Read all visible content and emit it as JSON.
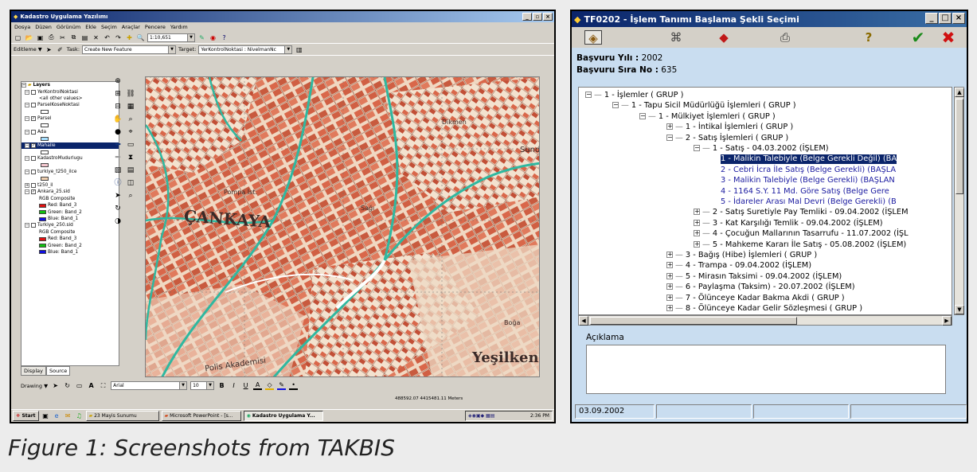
{
  "left_window": {
    "title": "Kadastro Uygulama Yazılımı",
    "menu": [
      "Dosya",
      "Düzen",
      "Görünüm",
      "Ekle",
      "Seçim",
      "Araçlar",
      "Pencere",
      "Yardım"
    ],
    "scale_value": "1:10,651",
    "editor_label": "Editleme ▼",
    "task_label": "Task:",
    "task_value": "Create New Feature",
    "target_label": "Target:",
    "target_value": "YerKontrolNoktasi : NivelmanNc",
    "layers_header": "Layers",
    "layers": [
      {
        "name": "YerKontrolNoktasi",
        "checked": false,
        "expanded": true
      },
      {
        "name": "<all other values>",
        "sub": true
      },
      {
        "name": "ParselKoseNoktasi",
        "checked": false,
        "expanded": true
      },
      {
        "name": "Parsel",
        "checked": true,
        "expanded": true
      },
      {
        "name": "Ada",
        "checked": false,
        "expanded": true
      },
      {
        "name": "Mahalle",
        "checked": true,
        "expanded": true,
        "selected": true
      },
      {
        "name": "KadastroMudurlugu",
        "checked": false,
        "expanded": true
      },
      {
        "name": "turkiye_t250_ilce",
        "checked": false,
        "expanded": true
      },
      {
        "name": "t250_il",
        "checked": false,
        "expanded": false
      },
      {
        "name": "Ankara_25.sid",
        "checked": true,
        "expanded": true
      },
      {
        "name": "RGB Composite",
        "sub": true
      },
      {
        "name": "Red:   Band_3",
        "sub": true,
        "color": "#e01010"
      },
      {
        "name": "Green: Band_2",
        "sub": true,
        "color": "#10c010"
      },
      {
        "name": "Blue:   Band_1",
        "sub": true,
        "color": "#1010e0"
      },
      {
        "name": "Turkiye_250.sid",
        "checked": false,
        "expanded": true
      },
      {
        "name": "RGB Composite",
        "sub": true
      },
      {
        "name": "Red:   Band_3",
        "sub": true,
        "color": "#e01010"
      },
      {
        "name": "Green: Band_2",
        "sub": true,
        "color": "#10c010"
      },
      {
        "name": "Blue:   Band_1",
        "sub": true,
        "color": "#1010e0"
      }
    ],
    "tabs": [
      "Display",
      "Source"
    ],
    "drawing_label": "Drawing ▼",
    "font_name": "Arial",
    "font_size": "10",
    "coords": "488592.07  4415481.11 Meters",
    "map_labels": [
      "ÇANKAYA",
      "Yeşilkent",
      "Dikmen",
      "Sund",
      "Polis Akademisi",
      "Sağı",
      "Pompa İst.",
      "Boğa"
    ],
    "taskbar": {
      "start": "Start",
      "items": [
        "23 Mayis Sunumu",
        "Microsoft PowerPoint - [s...",
        "Kadastro Uygulama Y..."
      ],
      "time": "2:36 PM"
    }
  },
  "right_window": {
    "title": "TF0202 - İşlem Tanımı Başlama Şekli Seçimi",
    "basvuru_yili_label": "Başvuru Yılı :",
    "basvuru_yili": "2002",
    "basvuru_sira_label": "Başvuru Sıra No :",
    "basvuru_sira": "635",
    "tree": [
      {
        "text": "1 - İşlemler ( GRUP )",
        "level": 0,
        "exp": "-"
      },
      {
        "text": "1 - Tapu Sicil Müdürlüğü İşlemleri ( GRUP )",
        "level": 1,
        "exp": "-"
      },
      {
        "text": "1 - Mülkiyet İşlemleri ( GRUP )",
        "level": 2,
        "exp": "-"
      },
      {
        "text": "1 - İntikal İşlemleri ( GRUP )",
        "level": 3,
        "exp": "+"
      },
      {
        "text": "2 - Satış İşlemleri ( GRUP )",
        "level": 3,
        "exp": "-"
      },
      {
        "text": "1 - Satış - 04.03.2002 (İŞLEM)",
        "level": 4,
        "exp": "-"
      },
      {
        "text": "1 - Malikin Talebiyle (Belge Gerekli Değil) (BA",
        "level": 5,
        "leaf": true,
        "selected": true
      },
      {
        "text": "2 - Cebri İcra İle Satış (Belge Gerekli) (BAŞLA",
        "level": 5,
        "leaf": true
      },
      {
        "text": "3 - Malikin Talebiyle (Belge Gerekli) (BAŞLAN",
        "level": 5,
        "leaf": true
      },
      {
        "text": "4 - 1164 S.Y. 11 Md. Göre Satış (Belge Gere",
        "level": 5,
        "leaf": true
      },
      {
        "text": "5 - İdareler Arası Mal Devri (Belge Gerekli) (B",
        "level": 5,
        "leaf": true
      },
      {
        "text": "2 - Satış Suretiyle Pay Temliki - 09.04.2002 (İŞLEM",
        "level": 4,
        "exp": "+"
      },
      {
        "text": "3 - Kat Karşılığı Temlik - 09.04.2002 (İŞLEM)",
        "level": 4,
        "exp": "+"
      },
      {
        "text": "4 - Çocuğun Mallarının Tasarrufu - 11.07.2002 (İŞL",
        "level": 4,
        "exp": "+"
      },
      {
        "text": "5 - Mahkeme Kararı İle Satış - 05.08.2002 (İŞLEM)",
        "level": 4,
        "exp": "+"
      },
      {
        "text": "3 - Bağış (Hibe) İşlemleri ( GRUP )",
        "level": 3,
        "exp": "+"
      },
      {
        "text": "4 - Trampa - 09.04.2002 (İŞLEM)",
        "level": 3,
        "exp": "+"
      },
      {
        "text": "5 - Mirasın Taksimi - 09.04.2002 (İŞLEM)",
        "level": 3,
        "exp": "+"
      },
      {
        "text": "6 - Paylaşma (Taksim) - 20.07.2002 (İŞLEM)",
        "level": 3,
        "exp": "+"
      },
      {
        "text": "7 - Ölünceye Kadar Bakma Akdi ( GRUP )",
        "level": 3,
        "exp": "+"
      },
      {
        "text": "8 - Ölünceye Kadar Gelir Sözleşmesi ( GRUP )",
        "level": 3,
        "exp": "+"
      }
    ],
    "aciklama_label": "Açıklama",
    "aciklama_value": "",
    "status_date": "03.09.2002"
  },
  "caption": "Figure 1: Screenshots from TAKBIS",
  "colors": {
    "titlebar": "#0a246a",
    "map_parcel": "#d9674a",
    "road": "#2fb8a0",
    "dialog_bg": "#c9ddf0"
  }
}
